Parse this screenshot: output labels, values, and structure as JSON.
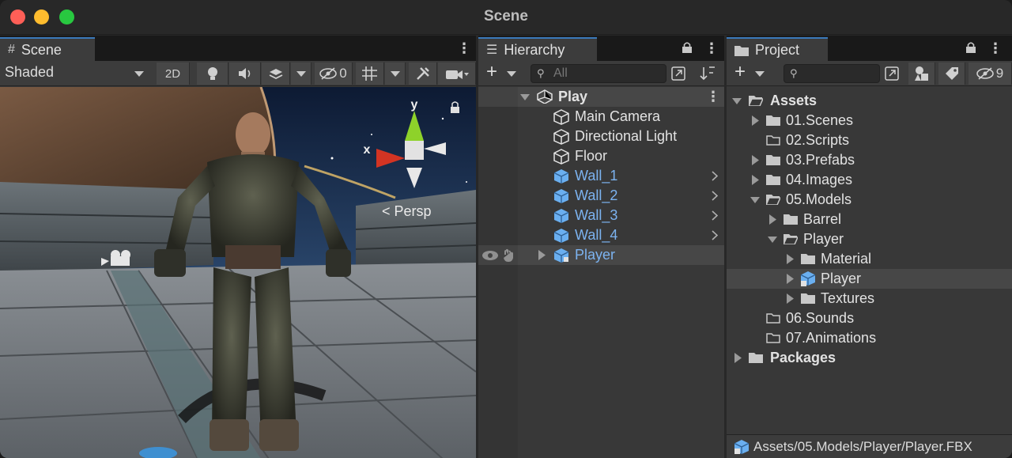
{
  "window": {
    "title": "Scene"
  },
  "scene": {
    "tab_label": "Scene",
    "shading_mode": "Shaded",
    "toolbar": {
      "mode_2d_label": "2D",
      "hidden_count": "0"
    },
    "gizmo": {
      "y_label": "y",
      "x_label": "x",
      "projection_label": "Persp"
    }
  },
  "hierarchy": {
    "tab_label": "Hierarchy",
    "search_placeholder": "All",
    "root": {
      "label": "Play"
    },
    "items": [
      {
        "label": "Main Camera",
        "style": "white"
      },
      {
        "label": "Directional Light",
        "style": "white"
      },
      {
        "label": "Floor",
        "style": "white"
      },
      {
        "label": "Wall_1",
        "style": "blue"
      },
      {
        "label": "Wall_2",
        "style": "blue"
      },
      {
        "label": "Wall_3",
        "style": "blue"
      },
      {
        "label": "Wall_4",
        "style": "blue"
      },
      {
        "label": "Player",
        "style": "blue"
      }
    ]
  },
  "project": {
    "tab_label": "Project",
    "hidden_count": "9",
    "tree": {
      "assets": "Assets",
      "scenes": "01.Scenes",
      "scripts": "02.Scripts",
      "prefabs": "03.Prefabs",
      "images": "04.Images",
      "models": "05.Models",
      "barrel": "Barrel",
      "player_folder": "Player",
      "material": "Material",
      "player_asset": "Player",
      "textures": "Textures",
      "sounds": "06.Sounds",
      "animations": "07.Animations",
      "packages": "Packages"
    },
    "status_path": "Assets/05.Models/Player/Player.FBX"
  },
  "colors": {
    "accent": "#3a79bb",
    "prefab_blue": "#7cb3f0",
    "selection": "#474747",
    "panel": "#383838"
  }
}
